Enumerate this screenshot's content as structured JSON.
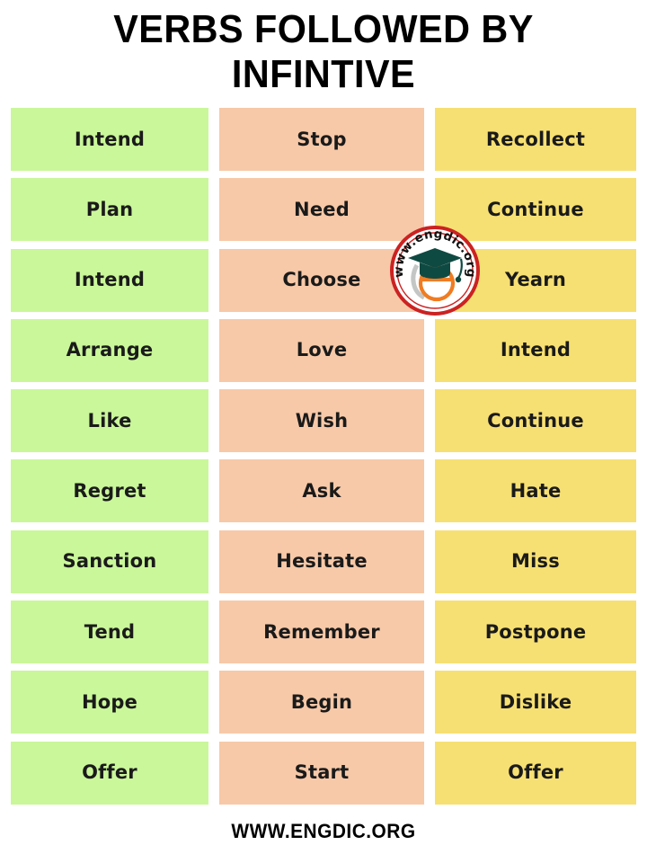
{
  "title": {
    "line1": "VERBS FOLLOWED BY",
    "line2": "INFINTIVE"
  },
  "footer": {
    "text": "WWW.ENGDIC.ORG"
  },
  "logo": {
    "alt": "engdic-logo",
    "ring_text": "www.engdic.org",
    "ring_color": "#cc2222",
    "cap_color": "#0f4a42",
    "letter_color": "#f07c22",
    "letter": "e"
  },
  "colors": {
    "column_1": "#caf79a",
    "column_2": "#f7c9a8",
    "column_3": "#f7e073",
    "background": "#ffffff",
    "text": "#1a1a1a"
  },
  "table": {
    "columns": [
      {
        "name": "column-green",
        "color": "#caf79a",
        "cells": [
          "Intend",
          "Plan",
          "Intend",
          "Arrange",
          "Like",
          "Regret",
          "Sanction",
          "Tend",
          "Hope",
          "Offer"
        ]
      },
      {
        "name": "column-peach",
        "color": "#f7c9a8",
        "cells": [
          "Stop",
          "Need",
          "Choose",
          "Love",
          "Wish",
          "Ask",
          "Hesitate",
          "Remember",
          "Begin",
          "Start"
        ]
      },
      {
        "name": "column-yellow",
        "color": "#f7e073",
        "cells": [
          "Recollect",
          "Continue",
          "Yearn",
          "Intend",
          "Continue",
          "Hate",
          "Miss",
          "Postpone",
          "Dislike",
          "Offer"
        ]
      }
    ],
    "rows": 10
  }
}
